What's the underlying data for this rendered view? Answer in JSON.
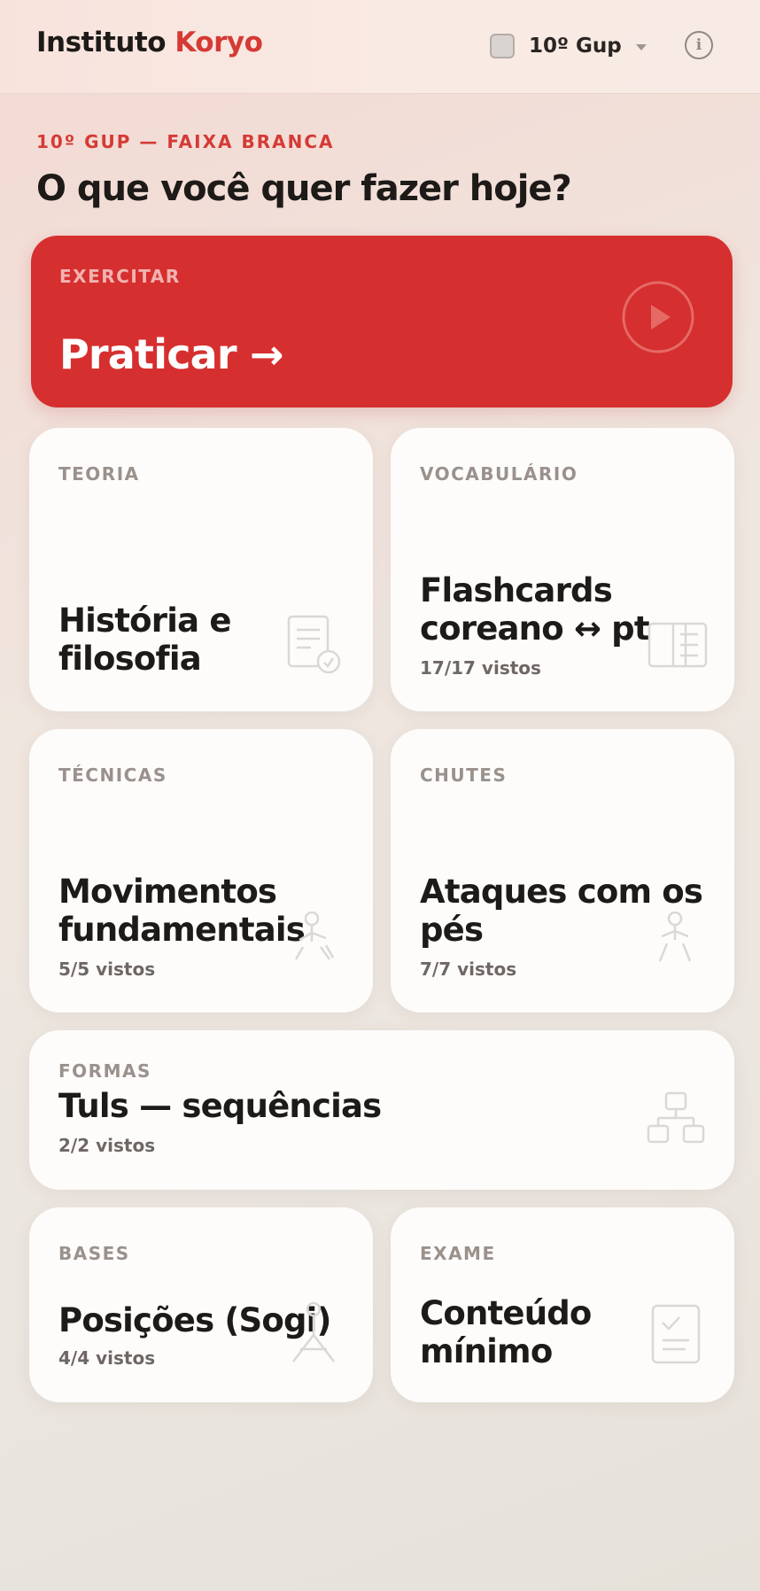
{
  "header": {
    "brand_main": "Instituto",
    "brand_accent": "Koryo",
    "level_label": "10º Gup",
    "info_label": "i"
  },
  "intro": {
    "eyebrow": "10º GUP — FAIXA BRANCA",
    "title": "O que você quer fazer hoje?"
  },
  "cards": {
    "practice": {
      "kicker": "EXERCITAR",
      "title": "Praticar →",
      "icon": "play-icon"
    },
    "theory": {
      "kicker": "TEORIA",
      "title_line1": "História e",
      "title_line2": "filosofia",
      "icon": "document-icon"
    },
    "vocab": {
      "kicker": "VOCABULÁRIO",
      "title_line1": "Flashcards",
      "title_line2": "coreano ↔ pt",
      "meta": "17/17 vistos",
      "icon": "book-icon"
    },
    "tech": {
      "kicker": "TÉCNICAS",
      "title_line1": "Movimentos",
      "title_line2": "fundamentais",
      "meta": "5/5 vistos",
      "icon": "figure-icon"
    },
    "kicks": {
      "kicker": "CHUTES",
      "title_line1": "Ataques com os",
      "title_line2": "pés",
      "meta": "7/7 vistos",
      "icon": "figure-icon"
    },
    "forms": {
      "kicker": "FORMAS",
      "title": "Tuls — sequências",
      "meta": "2/2 vistos",
      "icon": "hierarchy-icon"
    },
    "bases": {
      "kicker": "BASES",
      "title": "Posições (Sogi)",
      "meta": "4/4 vistos",
      "icon": "stance-icon"
    },
    "exam": {
      "kicker": "EXAME",
      "title_line1": "Conteúdo",
      "title_line2": "mínimo",
      "icon": "checklist-icon"
    }
  },
  "colors": {
    "accent": "#d53a35",
    "practice_bg": "#d62f2f",
    "card_bg": "#fdfcfb"
  }
}
